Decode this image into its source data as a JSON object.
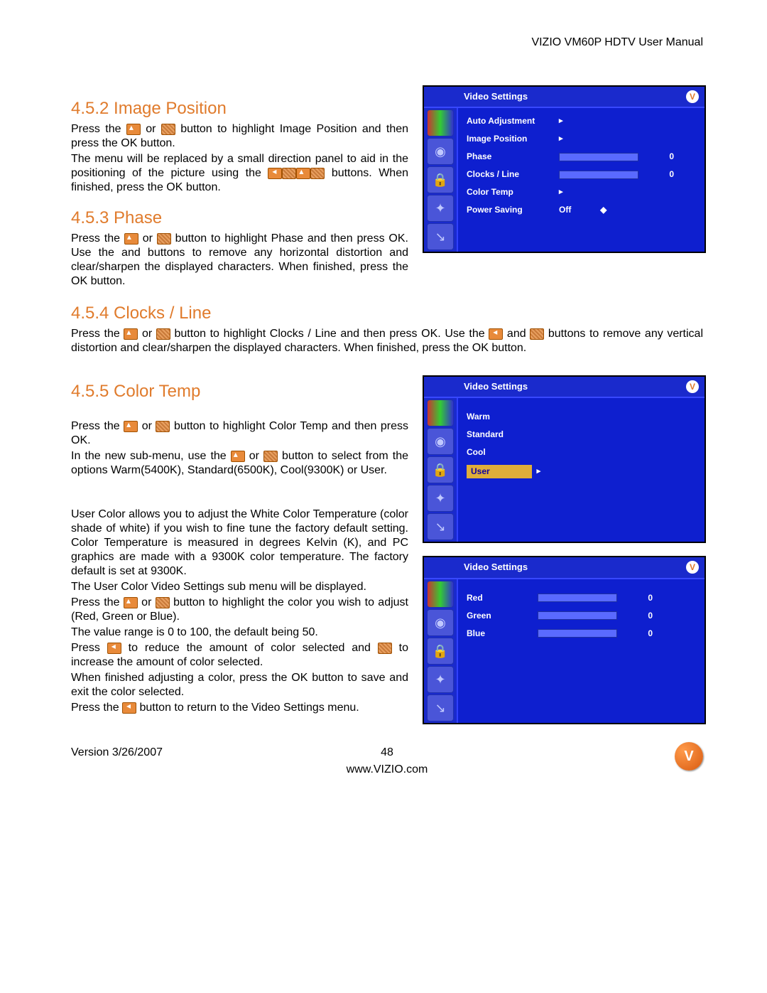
{
  "header": {
    "title": "VIZIO VM60P HDTV User Manual"
  },
  "sections": {
    "s452": {
      "heading": "4.5.2   Image Position",
      "p1a": "Press the ",
      "p1b": " or ",
      "p1c": " button to highlight Image Position and then press the OK button.",
      "p2a": "The menu will be replaced by a small direction panel to aid in the positioning of the picture using the ",
      "p2b": " buttons.  When finished, press the OK button."
    },
    "s453": {
      "heading": "4.5.3   Phase",
      "p1a": "Press the ",
      "p1b": " or ",
      "p1c": "  button to highlight Phase and then press OK.  Use the         and         buttons to remove any horizontal distortion and clear/sharpen the displayed characters.  When finished, press the OK button."
    },
    "s454": {
      "heading": "4.5.4   Clocks / Line",
      "p1a": "Press the ",
      "p1b": " or ",
      "p1c": "  button to highlight Clocks / Line and then press OK.  Use the ",
      "p1d": " and ",
      "p1e": "  buttons to remove any vertical distortion and clear/sharpen the displayed characters.  When finished, press the OK button."
    },
    "s455": {
      "heading": "4.5.5   Color Temp",
      "p1a": "Press the ",
      "p1b": " or ",
      "p1c": " button to highlight Color Temp and then press OK.",
      "p2a": "In the new sub-menu, use the ",
      "p2b": " or ",
      "p2c": "  button to select from the options Warm(5400K), Standard(6500K), Cool(9300K) or User.",
      "p3": "User Color allows you to adjust the White Color Temperature (color shade of white) if you wish to fine tune the factory default setting.  Color Temperature is measured in degrees Kelvin (K), and PC graphics are made with a 9300K color temperature.  The factory default is set at 9300K.",
      "p4": "The User Color Video Settings sub menu will be displayed.",
      "p5a": "Press the ",
      "p5b": " or ",
      "p5c": " button to highlight the color you wish to adjust (Red, Green or Blue).",
      "p6": "The value range is 0 to 100, the default being 50.",
      "p7a": "Press ",
      "p7b": " to reduce the amount of color selected and ",
      "p7c": " to increase the amount of color selected.",
      "p8": "When finished adjusting a color, press the OK button to save and exit the color selected.",
      "p9a": "Press the ",
      "p9b": " button to return to the Video Settings menu."
    }
  },
  "osd1": {
    "title": "Video Settings",
    "rows": [
      {
        "label": "Auto Adjustment",
        "type": "arrow"
      },
      {
        "label": "Image Position",
        "type": "arrow"
      },
      {
        "label": "Phase",
        "type": "slider",
        "val": "0"
      },
      {
        "label": "Clocks / Line",
        "type": "slider",
        "val": "0"
      },
      {
        "label": "Color  Temp",
        "type": "arrow"
      },
      {
        "label": "Power Saving",
        "type": "text",
        "val": "Off",
        "extra": "◆"
      }
    ]
  },
  "osd2": {
    "title": "Video Settings",
    "rows": [
      {
        "label": "Warm"
      },
      {
        "label": "Standard"
      },
      {
        "label": "Cool"
      },
      {
        "label": "User",
        "selected": true,
        "arrow": true
      }
    ]
  },
  "osd3": {
    "title": "Video Settings",
    "rows": [
      {
        "label": "Red",
        "type": "slider",
        "val": "0"
      },
      {
        "label": "Green",
        "type": "slider",
        "val": "0"
      },
      {
        "label": "Blue",
        "type": "slider",
        "val": "0"
      }
    ]
  },
  "footer": {
    "version": "Version 3/26/2007",
    "page": "48",
    "url": "www.VIZIO.com",
    "logo": "V"
  }
}
